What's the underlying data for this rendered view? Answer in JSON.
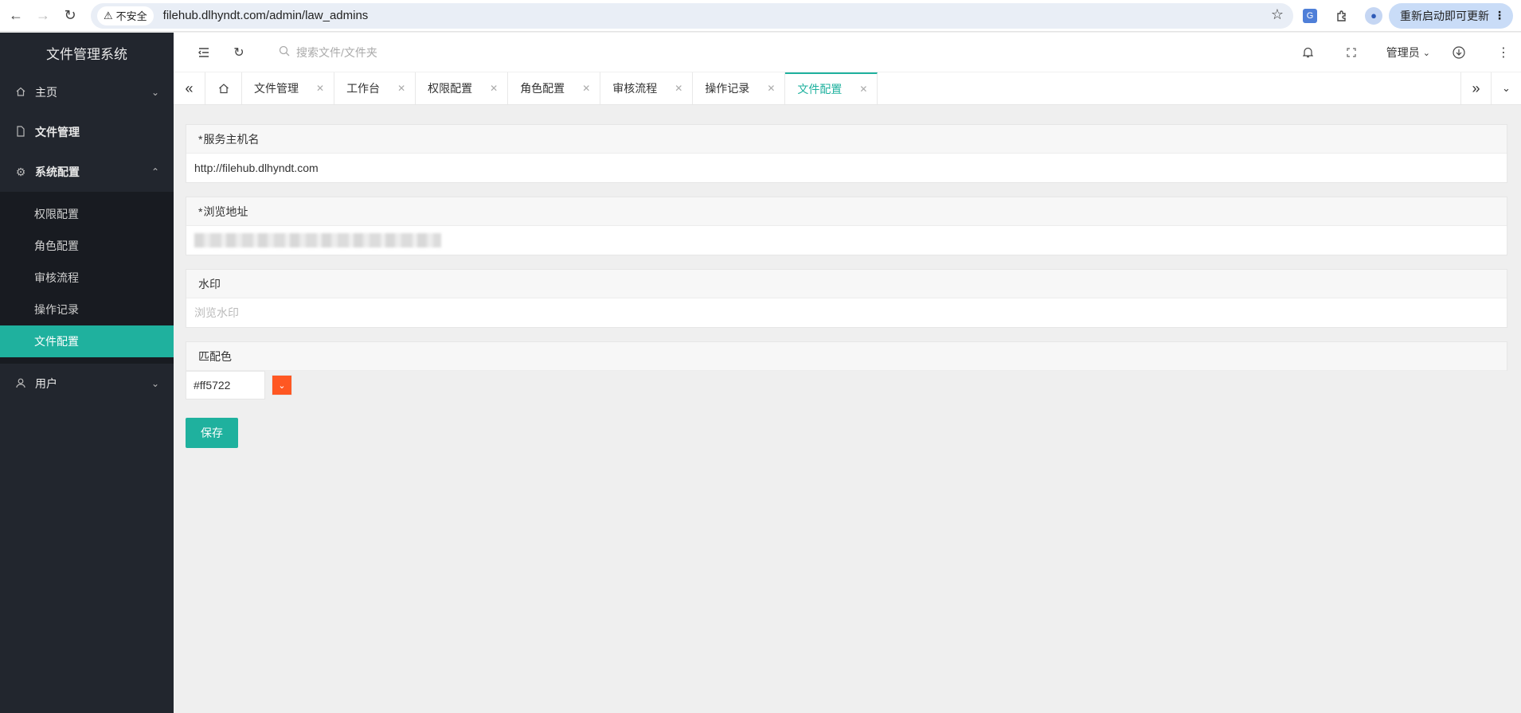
{
  "browser": {
    "insecure_label": "不安全",
    "url": "filehub.dlhyndt.com/admin/law_admins",
    "update_label": "重新启动即可更新"
  },
  "sidebar": {
    "brand": "文件管理系统",
    "items": [
      {
        "label": "主页",
        "icon": "home-icon"
      },
      {
        "label": "文件管理",
        "icon": "document-icon"
      },
      {
        "label": "系统配置",
        "icon": "gear-icon"
      },
      {
        "label": "用户",
        "icon": "user-icon"
      }
    ],
    "submenu": [
      "权限配置",
      "角色配置",
      "审核流程",
      "操作记录",
      "文件配置"
    ],
    "active_sub": "文件配置"
  },
  "header": {
    "search_placeholder": "搜索文件/文件夹",
    "user_label": "管理员"
  },
  "tabs": [
    {
      "label": "文件管理"
    },
    {
      "label": "工作台"
    },
    {
      "label": "权限配置"
    },
    {
      "label": "角色配置"
    },
    {
      "label": "审核流程"
    },
    {
      "label": "操作记录"
    },
    {
      "label": "文件配置",
      "active": true
    }
  ],
  "form": {
    "host": {
      "required_mark": "*",
      "label": "服务主机名",
      "value": "http://filehub.dlhyndt.com"
    },
    "browse": {
      "required_mark": "*",
      "label": "浏览地址"
    },
    "watermark": {
      "label": "水印",
      "placeholder": "浏览水印"
    },
    "color": {
      "label": "匹配色",
      "value": "#ff5722"
    },
    "save_label": "保存"
  },
  "colors": {
    "accent": "#1fb19e",
    "sidebar_bg": "#22262e",
    "swatch": "#ff5722"
  }
}
